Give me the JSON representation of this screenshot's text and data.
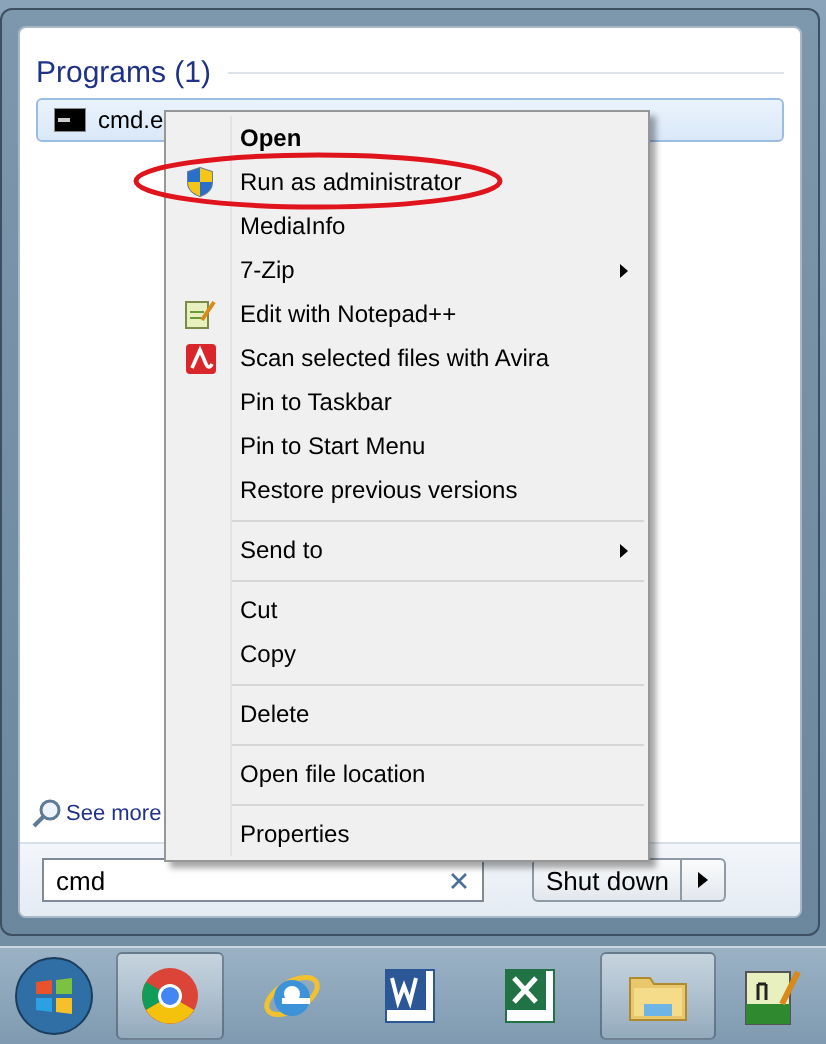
{
  "start_menu": {
    "section_title": "Programs (1)",
    "results": [
      {
        "label": "cmd.e",
        "selected": true
      }
    ],
    "see_more": "See more",
    "search": {
      "value": "cmd"
    },
    "shut_down": {
      "label": "Shut down"
    }
  },
  "context_menu": {
    "items": [
      {
        "kind": "item",
        "label": "Open",
        "default": true,
        "submenu": false
      },
      {
        "kind": "item",
        "label": "Run as administrator",
        "default": false,
        "submenu": false
      },
      {
        "kind": "item",
        "label": "MediaInfo",
        "default": false,
        "submenu": false
      },
      {
        "kind": "item",
        "label": "7-Zip",
        "default": false,
        "submenu": true
      },
      {
        "kind": "item",
        "label": "Edit with Notepad++",
        "default": false,
        "submenu": false
      },
      {
        "kind": "item",
        "label": "Scan selected files with Avira",
        "default": false,
        "submenu": false
      },
      {
        "kind": "item",
        "label": "Pin to Taskbar",
        "default": false,
        "submenu": false
      },
      {
        "kind": "item",
        "label": "Pin to Start Menu",
        "default": false,
        "submenu": false
      },
      {
        "kind": "item",
        "label": "Restore previous versions",
        "default": false,
        "submenu": false
      },
      {
        "kind": "separator"
      },
      {
        "kind": "item",
        "label": "Send to",
        "default": false,
        "submenu": true
      },
      {
        "kind": "separator"
      },
      {
        "kind": "item",
        "label": "Cut",
        "default": false,
        "submenu": false
      },
      {
        "kind": "item",
        "label": "Copy",
        "default": false,
        "submenu": false
      },
      {
        "kind": "separator"
      },
      {
        "kind": "item",
        "label": "Delete",
        "default": false,
        "submenu": false
      },
      {
        "kind": "separator"
      },
      {
        "kind": "item",
        "label": "Open file location",
        "default": false,
        "submenu": false
      },
      {
        "kind": "separator"
      },
      {
        "kind": "item",
        "label": "Properties",
        "default": false,
        "submenu": false
      }
    ]
  },
  "taskbar": {
    "apps": [
      {
        "kind": "start",
        "running": false
      },
      {
        "kind": "chrome",
        "running": true
      },
      {
        "kind": "ie",
        "running": false
      },
      {
        "kind": "word",
        "running": false
      },
      {
        "kind": "excel",
        "running": false
      },
      {
        "kind": "explorer",
        "running": true
      },
      {
        "kind": "notepad",
        "running": false
      }
    ]
  }
}
